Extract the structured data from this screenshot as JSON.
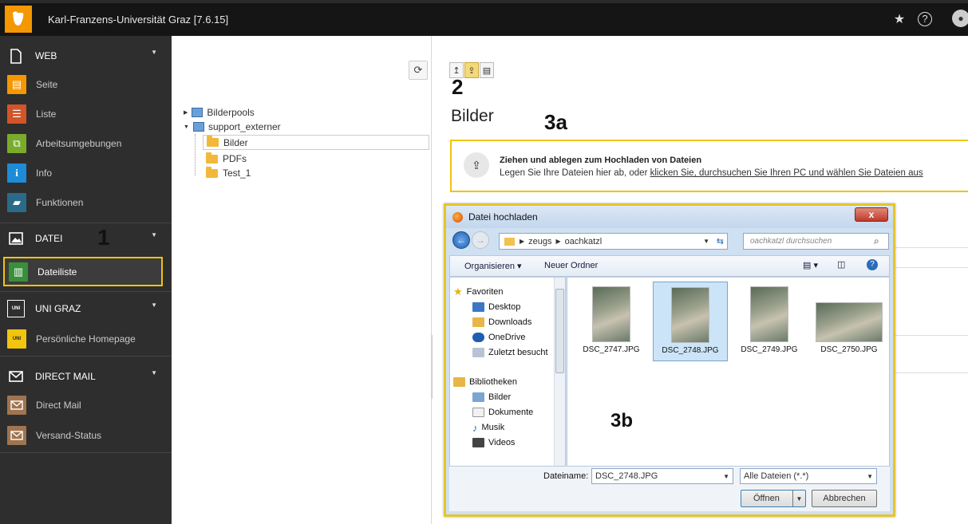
{
  "topbar": {
    "title": "Karl-Franzens-Universität Graz [7.6.15]"
  },
  "sidebar": {
    "groups": [
      {
        "label": "WEB",
        "items": [
          "Seite",
          "Liste",
          "Arbeitsumgebungen",
          "Info",
          "Funktionen"
        ]
      },
      {
        "label": "DATEI",
        "items": [
          "Dateiliste"
        ]
      },
      {
        "label": "UNI GRAZ",
        "items": [
          "Persönliche Homepage"
        ]
      },
      {
        "label": "DIRECT MAIL",
        "items": [
          "Direct Mail",
          "Versand-Status"
        ]
      }
    ],
    "colors": {
      "seite": "#f49700",
      "liste": "#d2552a",
      "arbeit": "#7aab2c",
      "info": "#1e8bd6",
      "funktionen": "#2b6b8a",
      "dateiliste": "#3a8f3a",
      "unigraz": "#f1c40f",
      "directmail": "#a07450"
    }
  },
  "tree": {
    "nodes": [
      "Bilderpools",
      "support_externer",
      "Bilder",
      "PDFs",
      "Test_1"
    ]
  },
  "content": {
    "heading": "Bilder",
    "dropzone": {
      "title": "Ziehen und ablegen zum Hochladen von Dateien",
      "text_prefix": "Legen Sie Ihre Dateien hier ab, oder ",
      "link": "klicken Sie, durchsuchen Sie Ihren PC und wählen Sie Dateien aus"
    }
  },
  "annotations": {
    "a1": "1",
    "a2": "2",
    "a3a": "3a",
    "a3b": "3b"
  },
  "dialog": {
    "title": "Datei hochladen",
    "close": "x",
    "path": [
      "zeugs",
      "oachkatzl"
    ],
    "search_placeholder": "oachkatzl durchsuchen",
    "commands": {
      "organize": "Organisieren ▾",
      "new_folder": "Neuer Ordner"
    },
    "nav": {
      "favorites": "Favoriten",
      "fav_items": [
        "Desktop",
        "Downloads",
        "OneDrive",
        "Zuletzt besucht"
      ],
      "libraries": "Bibliotheken",
      "lib_items": [
        "Bilder",
        "Dokumente",
        "Musik",
        "Videos"
      ]
    },
    "files": [
      "DSC_2747.JPG",
      "DSC_2748.JPG",
      "DSC_2749.JPG",
      "DSC_2750.JPG"
    ],
    "selected_file": "DSC_2748.JPG",
    "filename_label": "Dateiname:",
    "filename_value": "DSC_2748.JPG",
    "filetype": "Alle Dateien (*.*)",
    "open": "Öffnen",
    "cancel": "Abbrechen"
  }
}
